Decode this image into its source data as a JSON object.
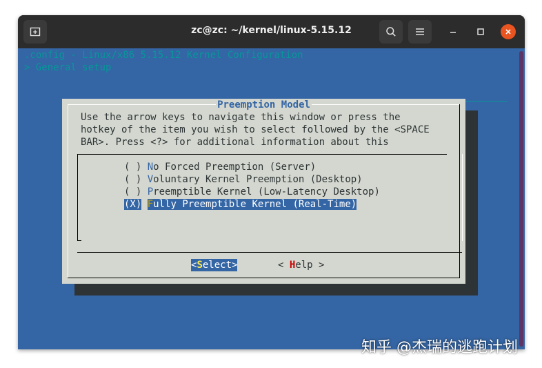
{
  "window": {
    "title": "zc@zc: ~/kernel/linux-5.15.12",
    "icons": {
      "new_tab": "new-tab-icon",
      "search": "search-icon",
      "menu": "hamburger-menu-icon",
      "minimize": "minimize-icon",
      "maximize": "maximize-icon",
      "close": "close-icon"
    },
    "colors": {
      "titlebar": "#2c2c2c",
      "terminal_bg": "#3465a4",
      "close_accent": "#e95420"
    }
  },
  "terminal": {
    "header_line": ".config - Linux/x86 5.15.12 Kernel Configuration",
    "breadcrumb": "> General setup"
  },
  "dialog": {
    "title": "Preemption Model",
    "help_lines": [
      "Use the arrow keys to navigate this window or press the",
      "hotkey of the item you wish to select followed by the <SPACE",
      "BAR>. Press <?> for additional information about this"
    ],
    "options": [
      {
        "radio": "( )",
        "hotkey": "N",
        "rest": "o Forced Preemption (Server)",
        "selected": false
      },
      {
        "radio": "( )",
        "hotkey": "V",
        "rest": "oluntary Kernel Preemption (Desktop)",
        "selected": false
      },
      {
        "radio": "( )",
        "hotkey": "P",
        "rest": "reemptible Kernel (Low-Latency Desktop)",
        "selected": false
      },
      {
        "radio": "(X)",
        "hotkey": "F",
        "rest": "ully Preemptible Kernel (Real-Time)",
        "selected": true
      }
    ],
    "buttons": {
      "select": {
        "open": "<",
        "hotkey": "S",
        "rest": "elect",
        "close": ">"
      },
      "help": {
        "open": "< ",
        "hotkey": "H",
        "rest": "elp",
        "close": " >"
      }
    }
  },
  "watermark": "知乎 @杰瑞的逃跑计划"
}
